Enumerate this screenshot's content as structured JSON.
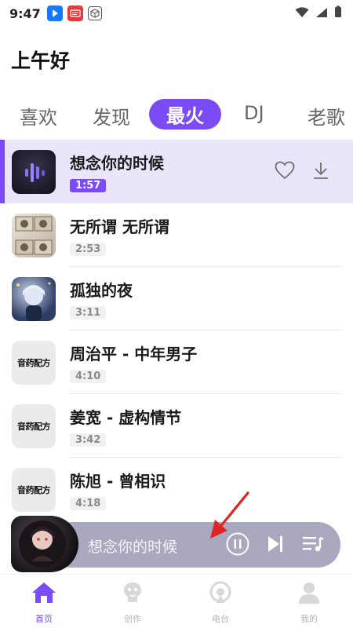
{
  "status_bar": {
    "time": "9:47",
    "app_icons": [
      {
        "name": "play-app-icon",
        "color": "#1677ff"
      },
      {
        "name": "news-app-icon",
        "color": "#e5393c"
      },
      {
        "name": "box-app-icon",
        "color": "#555555"
      }
    ]
  },
  "header": {
    "greeting": "上午好"
  },
  "tabs": [
    {
      "label": "喜欢",
      "active": false
    },
    {
      "label": "发现",
      "active": false
    },
    {
      "label": "最火",
      "active": true
    },
    {
      "label": "DJ",
      "active": false
    },
    {
      "label": "老歌",
      "active": false
    }
  ],
  "songs": [
    {
      "title": "想念你的时候",
      "duration": "1:57",
      "active": true,
      "cover": "waveform-cover"
    },
    {
      "title": "无所谓 无所谓",
      "duration": "2:53",
      "active": false,
      "cover": "comic-cover"
    },
    {
      "title": "孤独的夜",
      "duration": "3:11",
      "active": false,
      "cover": "anime-cover"
    },
    {
      "title": "周治平 - 中年男子",
      "duration": "4:10",
      "active": false,
      "cover": "brand-cover"
    },
    {
      "title": "姜宽 - 虚构情节",
      "duration": "3:42",
      "active": false,
      "cover": "brand-cover"
    },
    {
      "title": "陈旭 - 曾相识",
      "duration": "4:18",
      "active": false,
      "cover": "brand-cover"
    }
  ],
  "brand_cover_text": "音药配方",
  "player": {
    "title": "想念你的时候",
    "controls": [
      "pause-icon",
      "next-icon",
      "playlist-icon"
    ]
  },
  "nav": [
    {
      "label": "首页",
      "icon": "home-icon",
      "active": true
    },
    {
      "label": "创作",
      "icon": "create-icon",
      "active": false
    },
    {
      "label": "电台",
      "icon": "radio-icon",
      "active": false
    },
    {
      "label": "我的",
      "icon": "profile-icon",
      "active": false
    }
  ],
  "colors": {
    "accent": "#7b4cf5",
    "active_row_bg": "#ebe5fb",
    "player_bg": "#aaa8bf",
    "inactive_nav": "#b4b4b4"
  }
}
